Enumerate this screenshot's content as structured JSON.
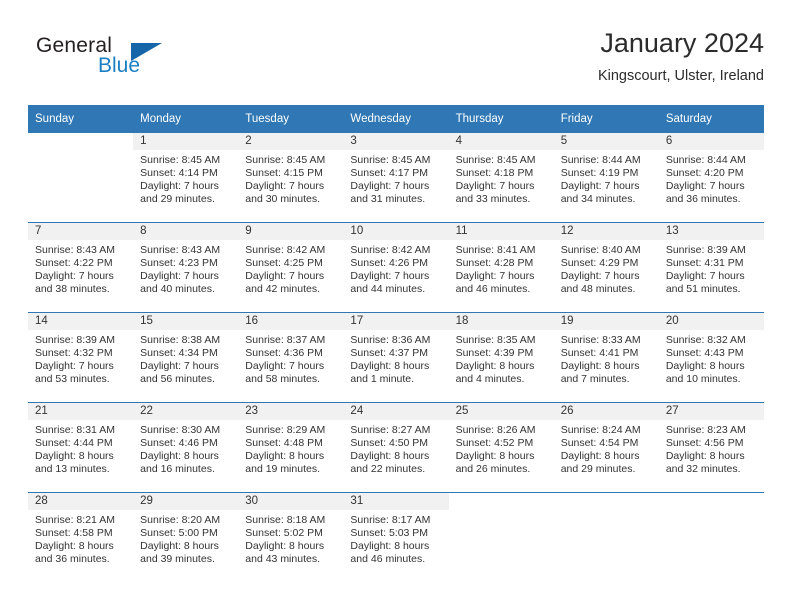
{
  "brand": {
    "name_part1": "General",
    "name_part2": "Blue",
    "triangle_icon": "triangle-logo-icon",
    "color_dark": "#231f20",
    "color_blue": "#1b7fc4",
    "color_triangle": "#1565a8"
  },
  "header": {
    "title": "January 2024",
    "location": "Kingscourt, Ulster, Ireland"
  },
  "theme": {
    "header_bg": "#2f77b5",
    "header_text": "#ffffff",
    "daynum_band_bg": "#f1f1f1",
    "cell_bg": "#ffffff",
    "row_divider": "#2f77b5",
    "body_text": "#333333"
  },
  "weekday_headers": [
    "Sunday",
    "Monday",
    "Tuesday",
    "Wednesday",
    "Thursday",
    "Friday",
    "Saturday"
  ],
  "weeks": [
    [
      {
        "day": "",
        "sunrise": "",
        "sunset": "",
        "daylight": "",
        "empty": true
      },
      {
        "day": "1",
        "sunrise": "Sunrise: 8:45 AM",
        "sunset": "Sunset: 4:14 PM",
        "daylight": "Daylight: 7 hours and 29 minutes."
      },
      {
        "day": "2",
        "sunrise": "Sunrise: 8:45 AM",
        "sunset": "Sunset: 4:15 PM",
        "daylight": "Daylight: 7 hours and 30 minutes."
      },
      {
        "day": "3",
        "sunrise": "Sunrise: 8:45 AM",
        "sunset": "Sunset: 4:17 PM",
        "daylight": "Daylight: 7 hours and 31 minutes."
      },
      {
        "day": "4",
        "sunrise": "Sunrise: 8:45 AM",
        "sunset": "Sunset: 4:18 PM",
        "daylight": "Daylight: 7 hours and 33 minutes."
      },
      {
        "day": "5",
        "sunrise": "Sunrise: 8:44 AM",
        "sunset": "Sunset: 4:19 PM",
        "daylight": "Daylight: 7 hours and 34 minutes."
      },
      {
        "day": "6",
        "sunrise": "Sunrise: 8:44 AM",
        "sunset": "Sunset: 4:20 PM",
        "daylight": "Daylight: 7 hours and 36 minutes."
      }
    ],
    [
      {
        "day": "7",
        "sunrise": "Sunrise: 8:43 AM",
        "sunset": "Sunset: 4:22 PM",
        "daylight": "Daylight: 7 hours and 38 minutes."
      },
      {
        "day": "8",
        "sunrise": "Sunrise: 8:43 AM",
        "sunset": "Sunset: 4:23 PM",
        "daylight": "Daylight: 7 hours and 40 minutes."
      },
      {
        "day": "9",
        "sunrise": "Sunrise: 8:42 AM",
        "sunset": "Sunset: 4:25 PM",
        "daylight": "Daylight: 7 hours and 42 minutes."
      },
      {
        "day": "10",
        "sunrise": "Sunrise: 8:42 AM",
        "sunset": "Sunset: 4:26 PM",
        "daylight": "Daylight: 7 hours and 44 minutes."
      },
      {
        "day": "11",
        "sunrise": "Sunrise: 8:41 AM",
        "sunset": "Sunset: 4:28 PM",
        "daylight": "Daylight: 7 hours and 46 minutes."
      },
      {
        "day": "12",
        "sunrise": "Sunrise: 8:40 AM",
        "sunset": "Sunset: 4:29 PM",
        "daylight": "Daylight: 7 hours and 48 minutes."
      },
      {
        "day": "13",
        "sunrise": "Sunrise: 8:39 AM",
        "sunset": "Sunset: 4:31 PM",
        "daylight": "Daylight: 7 hours and 51 minutes."
      }
    ],
    [
      {
        "day": "14",
        "sunrise": "Sunrise: 8:39 AM",
        "sunset": "Sunset: 4:32 PM",
        "daylight": "Daylight: 7 hours and 53 minutes."
      },
      {
        "day": "15",
        "sunrise": "Sunrise: 8:38 AM",
        "sunset": "Sunset: 4:34 PM",
        "daylight": "Daylight: 7 hours and 56 minutes."
      },
      {
        "day": "16",
        "sunrise": "Sunrise: 8:37 AM",
        "sunset": "Sunset: 4:36 PM",
        "daylight": "Daylight: 7 hours and 58 minutes."
      },
      {
        "day": "17",
        "sunrise": "Sunrise: 8:36 AM",
        "sunset": "Sunset: 4:37 PM",
        "daylight": "Daylight: 8 hours and 1 minute."
      },
      {
        "day": "18",
        "sunrise": "Sunrise: 8:35 AM",
        "sunset": "Sunset: 4:39 PM",
        "daylight": "Daylight: 8 hours and 4 minutes."
      },
      {
        "day": "19",
        "sunrise": "Sunrise: 8:33 AM",
        "sunset": "Sunset: 4:41 PM",
        "daylight": "Daylight: 8 hours and 7 minutes."
      },
      {
        "day": "20",
        "sunrise": "Sunrise: 8:32 AM",
        "sunset": "Sunset: 4:43 PM",
        "daylight": "Daylight: 8 hours and 10 minutes."
      }
    ],
    [
      {
        "day": "21",
        "sunrise": "Sunrise: 8:31 AM",
        "sunset": "Sunset: 4:44 PM",
        "daylight": "Daylight: 8 hours and 13 minutes."
      },
      {
        "day": "22",
        "sunrise": "Sunrise: 8:30 AM",
        "sunset": "Sunset: 4:46 PM",
        "daylight": "Daylight: 8 hours and 16 minutes."
      },
      {
        "day": "23",
        "sunrise": "Sunrise: 8:29 AM",
        "sunset": "Sunset: 4:48 PM",
        "daylight": "Daylight: 8 hours and 19 minutes."
      },
      {
        "day": "24",
        "sunrise": "Sunrise: 8:27 AM",
        "sunset": "Sunset: 4:50 PM",
        "daylight": "Daylight: 8 hours and 22 minutes."
      },
      {
        "day": "25",
        "sunrise": "Sunrise: 8:26 AM",
        "sunset": "Sunset: 4:52 PM",
        "daylight": "Daylight: 8 hours and 26 minutes."
      },
      {
        "day": "26",
        "sunrise": "Sunrise: 8:24 AM",
        "sunset": "Sunset: 4:54 PM",
        "daylight": "Daylight: 8 hours and 29 minutes."
      },
      {
        "day": "27",
        "sunrise": "Sunrise: 8:23 AM",
        "sunset": "Sunset: 4:56 PM",
        "daylight": "Daylight: 8 hours and 32 minutes."
      }
    ],
    [
      {
        "day": "28",
        "sunrise": "Sunrise: 8:21 AM",
        "sunset": "Sunset: 4:58 PM",
        "daylight": "Daylight: 8 hours and 36 minutes."
      },
      {
        "day": "29",
        "sunrise": "Sunrise: 8:20 AM",
        "sunset": "Sunset: 5:00 PM",
        "daylight": "Daylight: 8 hours and 39 minutes."
      },
      {
        "day": "30",
        "sunrise": "Sunrise: 8:18 AM",
        "sunset": "Sunset: 5:02 PM",
        "daylight": "Daylight: 8 hours and 43 minutes."
      },
      {
        "day": "31",
        "sunrise": "Sunrise: 8:17 AM",
        "sunset": "Sunset: 5:03 PM",
        "daylight": "Daylight: 8 hours and 46 minutes."
      },
      {
        "day": "",
        "sunrise": "",
        "sunset": "",
        "daylight": "",
        "empty": true
      },
      {
        "day": "",
        "sunrise": "",
        "sunset": "",
        "daylight": "",
        "empty": true
      },
      {
        "day": "",
        "sunrise": "",
        "sunset": "",
        "daylight": "",
        "empty": true
      }
    ]
  ]
}
